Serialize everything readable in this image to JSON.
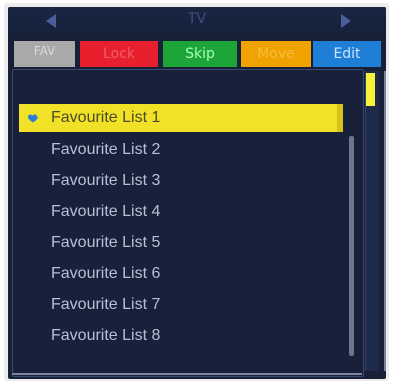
{
  "window": {
    "title": "TV"
  },
  "tabs": [
    {
      "key": "fav",
      "label": "FAV"
    },
    {
      "key": "lock",
      "label": "Lock"
    },
    {
      "key": "skip",
      "label": "Skip"
    },
    {
      "key": "move",
      "label": "Move"
    },
    {
      "key": "edit",
      "label": "Edit"
    }
  ],
  "list": {
    "selected_index": 0,
    "items": [
      "Favourite List 1",
      "Favourite List 2",
      "Favourite List 3",
      "Favourite List 4",
      "Favourite List 5",
      "Favourite List 6",
      "Favourite List 7",
      "Favourite List 8"
    ]
  },
  "icons": {
    "favourite": "heart-icon",
    "prev": "arrow-left-icon",
    "next": "arrow-right-icon"
  },
  "colors": {
    "background": "#182038",
    "selection": "#f2e227",
    "lock_tab": "#e8202e",
    "skip_tab": "#1ea53a",
    "move_tab": "#f0a200",
    "edit_tab": "#1f7fd6",
    "fav_tab": "#a9a9a9"
  }
}
